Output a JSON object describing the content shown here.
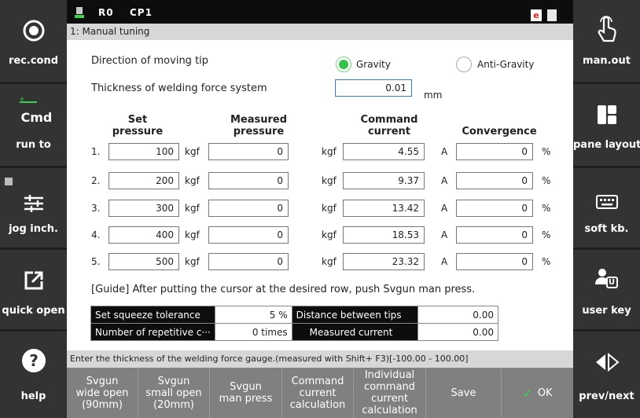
{
  "left_panel": [
    {
      "label": "rec.cond",
      "icon": "record-icon"
    },
    {
      "label": "run to",
      "icon": "cmd-run-to-icon",
      "icon_text": "Cmd"
    },
    {
      "label": "jog inch.",
      "icon": "sliders-icon"
    },
    {
      "label": "quick open",
      "icon": "external-open-icon"
    },
    {
      "label": "help",
      "icon": "help-icon"
    }
  ],
  "right_panel": [
    {
      "label": "man.out",
      "icon": "touch-hand-icon"
    },
    {
      "label": "pane layout",
      "icon": "pane-layout-icon"
    },
    {
      "label": "soft kb.",
      "icon": "keyboard-icon"
    },
    {
      "label": "user key",
      "icon": "user-key-icon",
      "icon_text": "U"
    },
    {
      "label": "prev/next",
      "icon": "prev-next-icon"
    }
  ],
  "topbar": {
    "robot": "R0",
    "program": "CP1",
    "badge": "e"
  },
  "window_title": "1: Manual tuning",
  "form": {
    "direction_label": "Direction of moving tip",
    "gravity_label": "Gravity",
    "anti_gravity_label": "Anti-Gravity",
    "gravity_selected": true,
    "thickness_label": "Thickness of welding force system",
    "thickness_value": "0.01",
    "thickness_unit": "mm"
  },
  "table": {
    "headers": {
      "set_1": "Set",
      "set_2": "pressure",
      "measured_1": "Measured",
      "measured_2": "pressure",
      "command_1": "Command",
      "command_2": "current",
      "convergence": "Convergence"
    },
    "rows": [
      {
        "no": "1.",
        "set": "100",
        "set_unit": "kgf",
        "measured": "0",
        "measured_unit": "kgf",
        "command": "4.55",
        "command_unit": "A",
        "convergence": "0",
        "conv_unit": "%"
      },
      {
        "no": "2.",
        "set": "200",
        "set_unit": "kgf",
        "measured": "0",
        "measured_unit": "kgf",
        "command": "9.37",
        "command_unit": "A",
        "convergence": "0",
        "conv_unit": "%"
      },
      {
        "no": "3.",
        "set": "300",
        "set_unit": "kgf",
        "measured": "0",
        "measured_unit": "kgf",
        "command": "13.42",
        "command_unit": "A",
        "convergence": "0",
        "conv_unit": "%"
      },
      {
        "no": "4.",
        "set": "400",
        "set_unit": "kgf",
        "measured": "0",
        "measured_unit": "kgf",
        "command": "18.53",
        "command_unit": "A",
        "convergence": "0",
        "conv_unit": "%"
      },
      {
        "no": "5.",
        "set": "500",
        "set_unit": "kgf",
        "measured": "0",
        "measured_unit": "kgf",
        "command": "23.32",
        "command_unit": "A",
        "convergence": "0",
        "conv_unit": "%"
      }
    ]
  },
  "guide": "[Guide] After putting the cursor at the desired row, push Svgun man press.",
  "info": {
    "squeeze_label": "Set squeeze tolerance",
    "squeeze_value": "5 %",
    "distance_label": "Distance between tips",
    "distance_value": "0.00",
    "repetitive_label": "Number of repetitive c···",
    "repetitive_value": "0 times",
    "measured_current_label": "Measured current",
    "measured_current_value": "0.00"
  },
  "status": "Enter the thickness of the welding force gauge.(measured with Shift+ F3)[-100.00 - 100.00]",
  "fkeys": [
    {
      "label": "Svgun\nwide open\n(90mm)"
    },
    {
      "label": "Svgun\nsmall open\n(20mm)"
    },
    {
      "label": "Svgun\nman press"
    },
    {
      "label": "Command\ncurrent\ncalculation"
    },
    {
      "label": "Individual\ncommand\ncurrent\ncalculation"
    },
    {
      "label": "Save"
    },
    {
      "label": "OK"
    }
  ],
  "colors": {
    "accent_green": "#35c14b",
    "badge_red": "#e02020",
    "panel": "#333333"
  }
}
